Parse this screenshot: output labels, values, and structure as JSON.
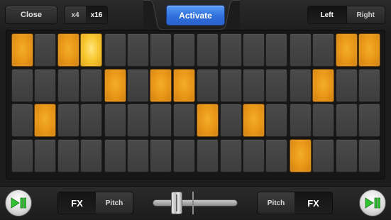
{
  "topbar": {
    "close_label": "Close",
    "multipliers": [
      {
        "label": "x4",
        "selected": false
      },
      {
        "label": "x16",
        "selected": true
      }
    ],
    "activate_label": "Activate",
    "sides": [
      {
        "label": "Left",
        "selected": true
      },
      {
        "label": "Right",
        "selected": false
      }
    ]
  },
  "colors": {
    "pad_on": "#e89516",
    "pad_hot": "#f8c830",
    "pad_off": "#444444",
    "activate_blue": "#2f6fdc"
  },
  "grid": {
    "rows": 4,
    "columns": 16,
    "pattern": [
      [
        1,
        0,
        1,
        2,
        0,
        0,
        0,
        0,
        0,
        0,
        0,
        0,
        0,
        0,
        1,
        1
      ],
      [
        0,
        0,
        0,
        0,
        1,
        0,
        1,
        1,
        0,
        0,
        0,
        0,
        0,
        1,
        0,
        0
      ],
      [
        0,
        1,
        0,
        0,
        0,
        0,
        0,
        0,
        1,
        0,
        1,
        0,
        0,
        0,
        0,
        0
      ],
      [
        0,
        0,
        0,
        0,
        0,
        0,
        0,
        0,
        0,
        0,
        0,
        0,
        1,
        0,
        0,
        0
      ]
    ]
  },
  "bottombar": {
    "left_fx": {
      "fx_label": "FX",
      "pitch_label": "Pitch"
    },
    "right_fx": {
      "pitch_label": "Pitch",
      "fx_label": "FX"
    },
    "play_icon": "play-pause-icon",
    "crossfader_level": 0.25
  }
}
